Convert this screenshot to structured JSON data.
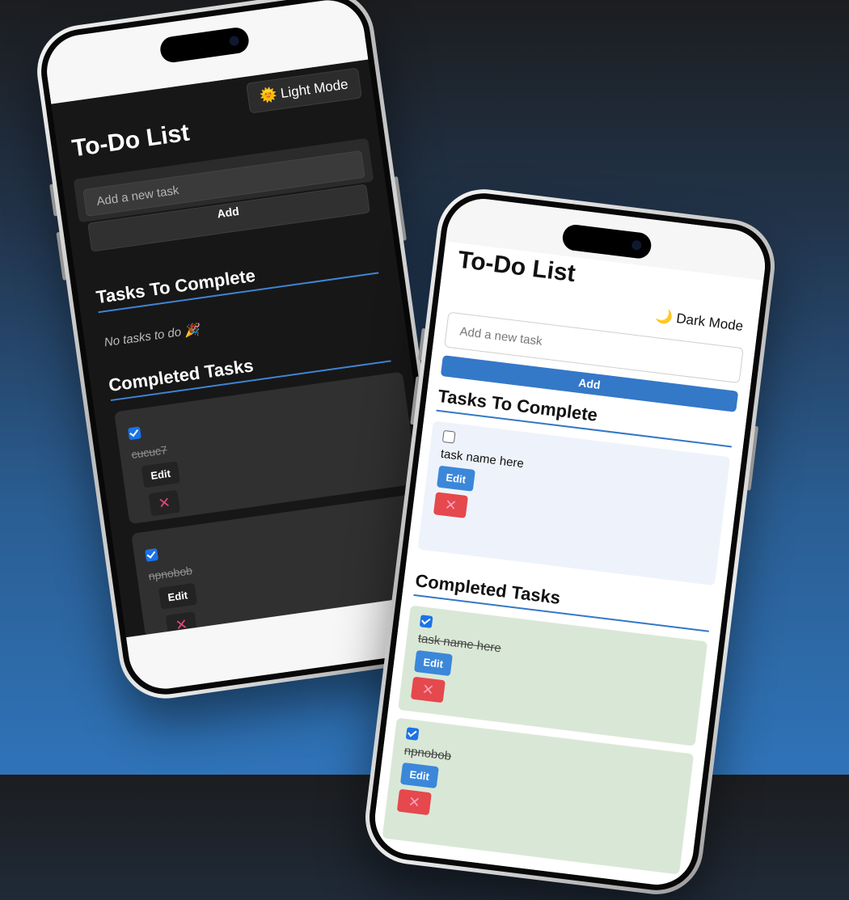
{
  "dark_phone": {
    "mode_toggle": {
      "icon": "🌞",
      "label": "Light Mode"
    },
    "title": "To-Do List",
    "input_placeholder": "Add a new task",
    "add_button": "Add",
    "to_complete_heading": "Tasks To Complete",
    "empty_message": "No tasks to do 🎉",
    "completed_heading": "Completed Tasks",
    "completed_tasks": [
      {
        "name": "cucuc7",
        "edit_label": "Edit",
        "delete_icon": "✕"
      },
      {
        "name": "npnobob",
        "edit_label": "Edit",
        "delete_icon": "✕"
      }
    ]
  },
  "light_phone": {
    "title": "To-Do List",
    "mode_toggle": {
      "icon": "🌙",
      "label": "Dark Mode"
    },
    "input_placeholder": "Add a new task",
    "add_button": "Add",
    "to_complete_heading": "Tasks To Complete",
    "todo_tasks": [
      {
        "name": "task name here",
        "edit_label": "Edit",
        "delete_icon": "✕"
      }
    ],
    "completed_heading": "Completed Tasks",
    "completed_tasks": [
      {
        "name": "task name here",
        "edit_label": "Edit",
        "delete_icon": "✕"
      },
      {
        "name": "npnobob",
        "edit_label": "Edit",
        "delete_icon": "✕"
      }
    ]
  },
  "colors": {
    "accent_blue": "#3478c8",
    "dark_bg": "#171717",
    "delete_red": "#e5484d",
    "completed_green": "#d9e8d6"
  }
}
